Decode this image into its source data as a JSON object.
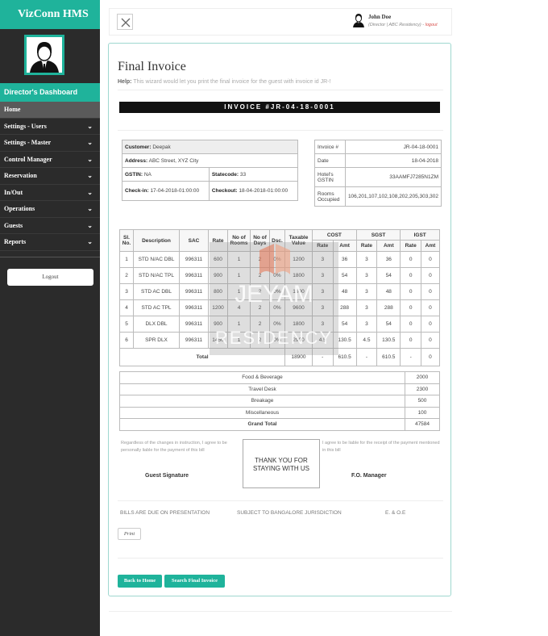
{
  "app": {
    "brand": "VizConn HMS"
  },
  "sidebar": {
    "dashboard_title": "Director's Dashboard",
    "items": [
      {
        "label": "Home",
        "has_submenu": false,
        "active": true
      },
      {
        "label": "Settings - Users",
        "has_submenu": true
      },
      {
        "label": "Settings - Master",
        "has_submenu": true
      },
      {
        "label": "Control Manager",
        "has_submenu": true
      },
      {
        "label": "Reservation",
        "has_submenu": true
      },
      {
        "label": "In/Out",
        "has_submenu": true
      },
      {
        "label": "Operations",
        "has_submenu": true
      },
      {
        "label": "Guests",
        "has_submenu": true
      },
      {
        "label": "Reports",
        "has_submenu": true
      }
    ],
    "chevron": "⌄",
    "logout_label": "Logout"
  },
  "header": {
    "user_name": "John Doe",
    "user_role": "(Director | ABC Residency) -",
    "logout_link": "logout"
  },
  "page": {
    "title": "Final Invoice",
    "help_label": "Help:",
    "help_text": "This wizard would let you print the final invoice for the guest with invoice id JR-!",
    "invoice_bar": "INVOICE #JR-04-18-0001"
  },
  "customer": {
    "customer_label": "Customer:",
    "customer_value": "Deepak",
    "address_label": "Address:",
    "address_value": "ABC Street, XYZ City",
    "gstin_label": "GSTIN:",
    "gstin_value": "NA",
    "statecode_label": "Statecode:",
    "statecode_value": "33",
    "checkin_label": "Check-in:",
    "checkin_value": "17-04-2018-01:00:00",
    "checkout_label": "Checkout:",
    "checkout_value": "18-04-2018-01:00:00"
  },
  "hotel_info": {
    "invoice_label": "Invoice #",
    "invoice_value": "JR-04-18-0001",
    "date_label": "Date",
    "date_value": "18-04-2018",
    "gstin_label": "Hotel's GSTIN",
    "gstin_value": "33AAMFJ7285N1ZM",
    "rooms_label": "Rooms Occupied",
    "rooms_value": "106,201,107,102,108,202,205,303,302"
  },
  "items_table": {
    "headers": {
      "sl": "Sl. No.",
      "desc": "Description",
      "sac": "SAC",
      "rate": "Rate",
      "rooms": "No of Rooms",
      "days": "No of Days",
      "dsc": "Dsc.",
      "taxable": "Taxable Value",
      "cost": "COST",
      "sgst": "SGST",
      "igst": "IGST",
      "sub_rate": "Rate",
      "sub_amt": "Amt"
    },
    "rows": [
      {
        "sl": "1",
        "desc": "STD N/AC DBL",
        "sac": "996311",
        "rate": "600",
        "rooms": "1",
        "days": "2",
        "dsc": "0%",
        "taxable": "1200",
        "cost_rate": "3",
        "cost_amt": "36",
        "sgst_rate": "3",
        "sgst_amt": "36",
        "igst_rate": "0",
        "igst_amt": "0"
      },
      {
        "sl": "2",
        "desc": "STD N/AC TPL",
        "sac": "996311",
        "rate": "900",
        "rooms": "1",
        "days": "2",
        "dsc": "0%",
        "taxable": "1800",
        "cost_rate": "3",
        "cost_amt": "54",
        "sgst_rate": "3",
        "sgst_amt": "54",
        "igst_rate": "0",
        "igst_amt": "0"
      },
      {
        "sl": "3",
        "desc": "STD AC DBL",
        "sac": "996311",
        "rate": "800",
        "rooms": "1",
        "days": "2",
        "dsc": "0%",
        "taxable": "1600",
        "cost_rate": "3",
        "cost_amt": "48",
        "sgst_rate": "3",
        "sgst_amt": "48",
        "igst_rate": "0",
        "igst_amt": "0"
      },
      {
        "sl": "4",
        "desc": "STD AC TPL",
        "sac": "996311",
        "rate": "1200",
        "rooms": "4",
        "days": "2",
        "dsc": "0%",
        "taxable": "9600",
        "cost_rate": "3",
        "cost_amt": "288",
        "sgst_rate": "3",
        "sgst_amt": "288",
        "igst_rate": "0",
        "igst_amt": "0"
      },
      {
        "sl": "5",
        "desc": "DLX DBL",
        "sac": "996311",
        "rate": "900",
        "rooms": "1",
        "days": "2",
        "dsc": "0%",
        "taxable": "1800",
        "cost_rate": "3",
        "cost_amt": "54",
        "sgst_rate": "3",
        "sgst_amt": "54",
        "igst_rate": "0",
        "igst_amt": "0"
      },
      {
        "sl": "6",
        "desc": "SPR DLX",
        "sac": "996311",
        "rate": "1450",
        "rooms": "1",
        "days": "2",
        "dsc": "0%",
        "taxable": "2900",
        "cost_rate": "4.5",
        "cost_amt": "130.5",
        "sgst_rate": "4.5",
        "sgst_amt": "130.5",
        "igst_rate": "0",
        "igst_amt": "0"
      }
    ],
    "total": {
      "label": "Total",
      "taxable": "18900",
      "cost_rate": "-",
      "cost_amt": "610.5",
      "sgst_rate": "-",
      "sgst_amt": "610.5",
      "igst_rate": "-",
      "igst_amt": "0"
    }
  },
  "extras": [
    {
      "label": "Food & Beverage",
      "amount": "2000"
    },
    {
      "label": "Travel Desk",
      "amount": "2300"
    },
    {
      "label": "Breakage",
      "amount": "500"
    },
    {
      "label": "Miscellaneous",
      "amount": "100"
    },
    {
      "label": "Grand Total",
      "amount": "47584",
      "bold": true
    }
  ],
  "signatures": {
    "left_note": "Regardless of the changes in instruction, I agree to be personally liable for the payment of this bill",
    "right_note": "I agree to be liable for the receipt of the payment mentioned in this bill",
    "thank_you_1": "THANK YOU FOR",
    "thank_you_2": "STAYING WITH US",
    "guest_label": "Guest Signature",
    "fo_label": "F.O. Manager"
  },
  "footer": {
    "note_a": "BILLS ARE DUE ON PRESENTATION",
    "note_b": "SUBJECT TO BANGALORE JURISDICTION",
    "note_c": "E. & O.E",
    "print_label": "Print",
    "back_label": "Back to Home",
    "search_label": "Search Final Invoice"
  },
  "watermark": {
    "line1": "JEYAM",
    "line2": "RESIDENCY"
  },
  "colors": {
    "accent": "#1fb39b",
    "sidebar": "#2b2b2b",
    "invoice_bar": "#111111",
    "logout_link": "#d9534f"
  },
  "icons": {
    "close": "close-icon",
    "user": "user-icon",
    "avatar": "avatar-icon",
    "chevron": "chevron-down-icon"
  }
}
